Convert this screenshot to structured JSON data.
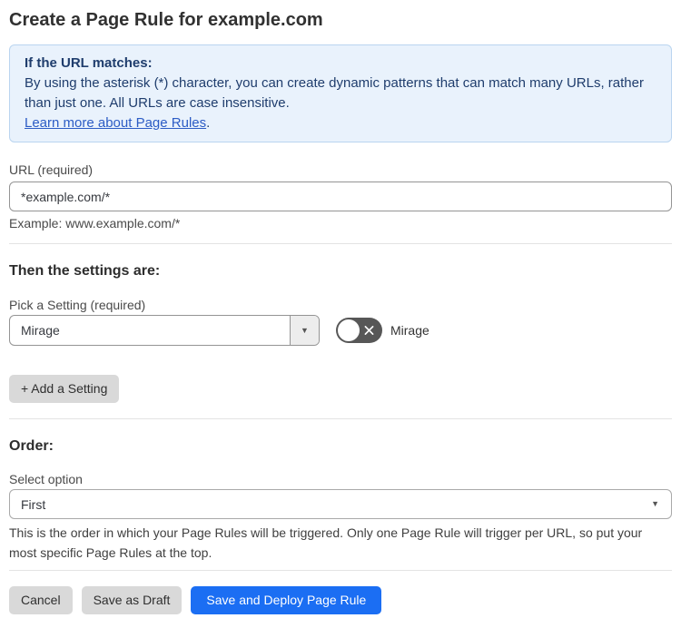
{
  "page": {
    "title": "Create a Page Rule for example.com"
  },
  "info_box": {
    "heading": "If the URL matches:",
    "body": "By using the asterisk (*) character, you can create dynamic patterns that can match many URLs, rather than just one. All URLs are case insensitive.",
    "link_label": "Learn more about Page Rules",
    "link_suffix": "."
  },
  "url_field": {
    "label": "URL (required)",
    "value": "*example.com/*",
    "helper": "Example: www.example.com/*"
  },
  "settings_section": {
    "heading": "Then the settings are:",
    "picker_label": "Pick a Setting (required)",
    "picker_value": "Mirage",
    "toggle_label": "Mirage",
    "toggle_state": "off",
    "add_button_label": "+ Add a Setting"
  },
  "order_section": {
    "heading": "Order:",
    "select_label": "Select option",
    "select_value": "First",
    "helper": "This is the order in which your Page Rules will be triggered. Only one Page Rule will trigger per URL, so put your most specific Page Rules at the top."
  },
  "actions": {
    "cancel_label": "Cancel",
    "save_draft_label": "Save as Draft",
    "save_deploy_label": "Save and Deploy Page Rule"
  },
  "colors": {
    "accent_blue": "#1b6ef3",
    "info_bg": "#e9f2fc",
    "info_border": "#bad5f0",
    "info_text": "#1f3d6d",
    "link_blue": "#2c5cc5",
    "gray_button_bg": "#d9d9d9",
    "toggle_off_bg": "#575757",
    "input_border": "#949494",
    "divider": "#e3e3e3"
  }
}
